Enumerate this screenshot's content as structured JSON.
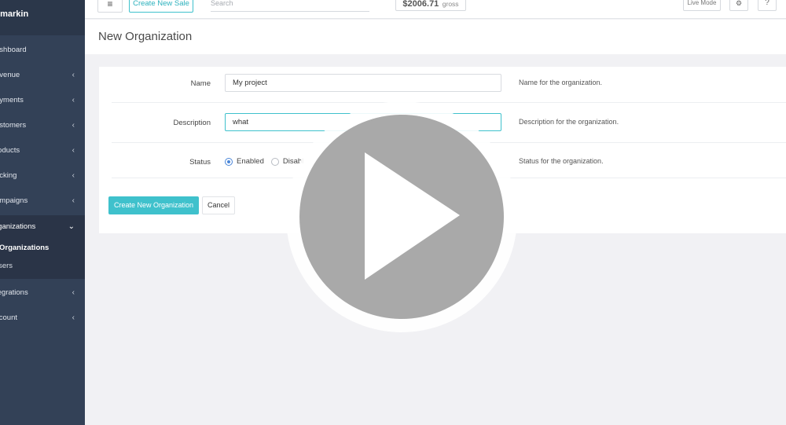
{
  "sidebar": {
    "brand": "markin",
    "items": [
      {
        "label": "ashboard",
        "chevron": ""
      },
      {
        "label": "evenue",
        "chevron": "‹"
      },
      {
        "label": "ayments",
        "chevron": "‹"
      },
      {
        "label": "ustomers",
        "chevron": "‹"
      },
      {
        "label": "roducts",
        "chevron": "‹"
      },
      {
        "label": "acking",
        "chevron": "‹"
      },
      {
        "label": "ampaigns",
        "chevron": "‹"
      },
      {
        "label": "rganizations",
        "chevron": "⌄"
      },
      {
        "label": "tegrations",
        "chevron": "‹"
      },
      {
        "label": "ccount",
        "chevron": "‹"
      }
    ],
    "sub_items": [
      {
        "label": "Organizations"
      },
      {
        "label": "lsers"
      }
    ]
  },
  "topbar": {
    "menu_glyph": "≡",
    "create_sale_label": "Create New Sale",
    "search_placeholder": "Search",
    "gross_amount": "$2006.71",
    "gross_suffix": "gross",
    "live_mode_label": "Live Mode",
    "gear_glyph": "⚙",
    "help_glyph": "?"
  },
  "page": {
    "title": "New Organization"
  },
  "form": {
    "name_label": "Name",
    "name_value": "My project",
    "name_help": "Name for the organization.",
    "description_label": "Description",
    "description_value": "what",
    "description_help": "Description for the organization.",
    "status_label": "Status",
    "status_options": [
      "Enabled",
      "Disabl"
    ],
    "status_selected": "Enabled",
    "status_help": "Status for the organization.",
    "create_label": "Create New Organization",
    "cancel_label": "Cancel"
  },
  "colors": {
    "accent": "#3fc1cc",
    "sidebar": "#334157",
    "radio_on": "#4a86d8"
  },
  "icons": [
    "menu-icon",
    "gear-icon",
    "help-icon",
    "chevron-left-icon",
    "chevron-down-icon",
    "play-icon"
  ]
}
